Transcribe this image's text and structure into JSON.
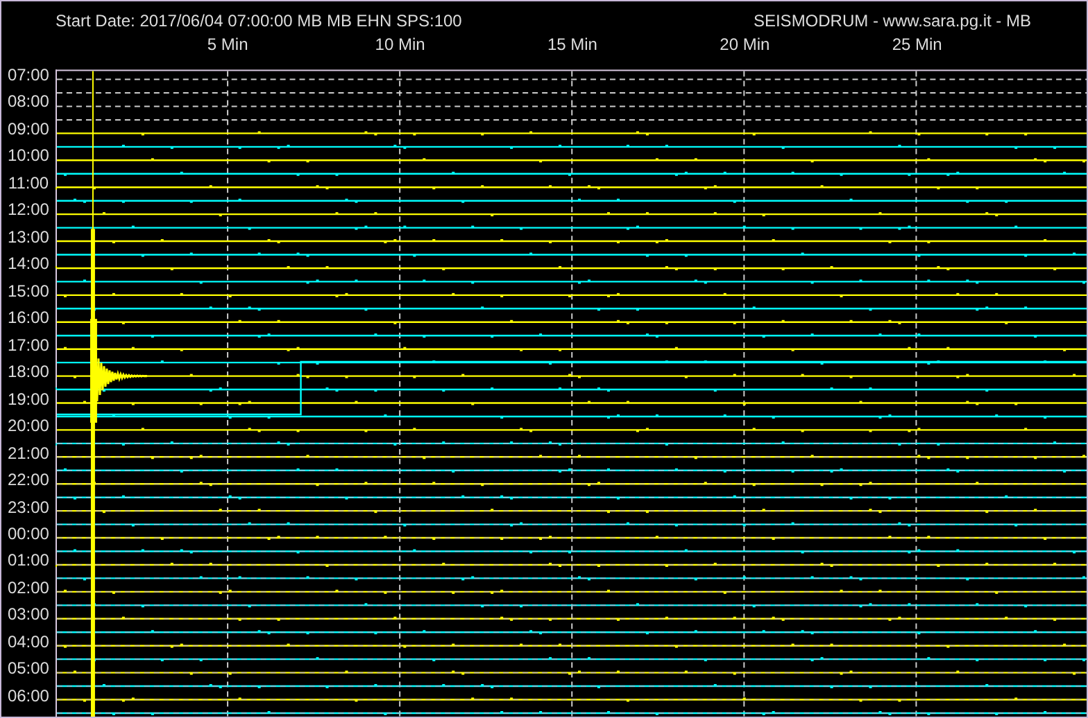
{
  "header": {
    "start_info": "Start Date: 2017/06/04 07:00:00 MB MB EHN SPS:100",
    "title": "SEISMODRUM - www.sara.pg.it - MB"
  },
  "minute_ticks": [
    "5 Min",
    "10 Min",
    "15 Min",
    "20 Min",
    "25 Min"
  ],
  "hour_labels": [
    "07:00",
    "08:00",
    "09:00",
    "10:00",
    "11:00",
    "12:00",
    "13:00",
    "14:00",
    "15:00",
    "16:00",
    "17:00",
    "18:00",
    "19:00",
    "20:00",
    "21:00",
    "22:00",
    "23:00",
    "00:00",
    "01:00",
    "02:00",
    "03:00",
    "04:00",
    "05:00",
    "06:00"
  ]
}
